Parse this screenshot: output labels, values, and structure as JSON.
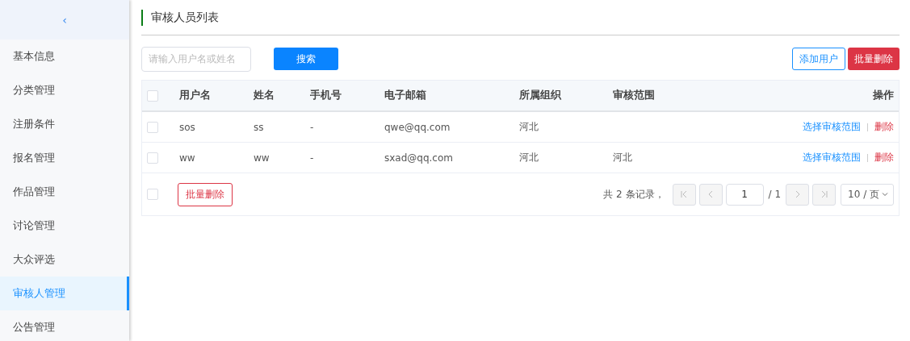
{
  "sidebar": {
    "collapse": "‹",
    "items": [
      {
        "label": "基本信息",
        "selected": false
      },
      {
        "label": "分类管理",
        "selected": false
      },
      {
        "label": "注册条件",
        "selected": false
      },
      {
        "label": "报名管理",
        "selected": false
      },
      {
        "label": "作品管理",
        "selected": false
      },
      {
        "label": "讨论管理",
        "selected": false
      },
      {
        "label": "大众评选",
        "selected": false
      },
      {
        "label": "审核人管理",
        "selected": true
      },
      {
        "label": "公告管理",
        "selected": false
      }
    ]
  },
  "page_title": "审核人员列表",
  "toolbar": {
    "search": {
      "placeholder": "请输入用户名或姓名"
    },
    "search_button": "搜索",
    "add_button": "添加用户",
    "batch_delete_button": "批量删除"
  },
  "table": {
    "select_all_checked": false,
    "columns": [
      "用户名",
      "姓名",
      "手机号",
      "电子邮箱",
      "所属组织",
      "审核范围",
      "操作"
    ],
    "rows": [
      {
        "checked": false,
        "cells": [
          "sos",
          "ss",
          "-",
          "qwe@qq.com",
          "河北",
          ""
        ],
        "actions": [
          "选择审核范围",
          "删除"
        ]
      },
      {
        "checked": false,
        "cells": [
          "ww",
          "ww",
          "-",
          "sxad@qq.com",
          "河北",
          "河北"
        ],
        "actions": [
          "选择审核范围",
          "删除"
        ]
      }
    ],
    "footer": {
      "checked": false,
      "batch_delete": "批量删除"
    }
  },
  "pager": {
    "summary": "共 2 条记录，",
    "buttons": [
      {
        "kind": "first",
        "disabled": true
      },
      {
        "kind": "prev",
        "disabled": true
      },
      {
        "kind": "next",
        "disabled": true
      },
      {
        "kind": "last",
        "disabled": true
      }
    ],
    "page": "1",
    "total": "/ 1",
    "page_size": "10 / 页"
  }
}
